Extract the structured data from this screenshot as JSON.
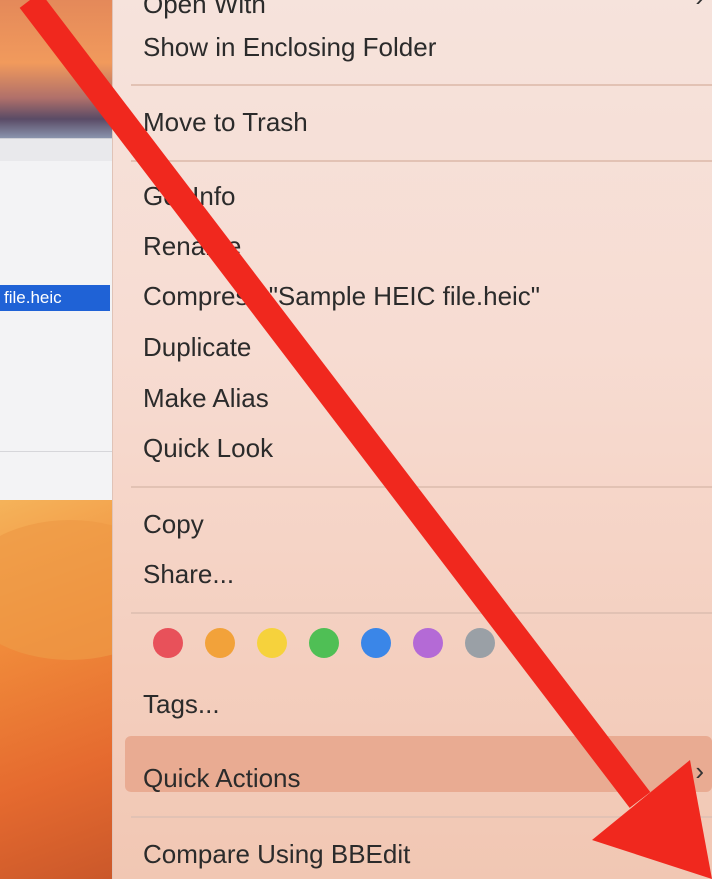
{
  "finder": {
    "selected_file": "file.heic"
  },
  "menu": {
    "items": [
      {
        "label": "Open With",
        "top": 0
      },
      {
        "label": "Show in Enclosing Folder",
        "top": 0
      },
      {
        "label": "Move to Trash",
        "top": 0
      },
      {
        "label": "Get Info",
        "top": 0
      },
      {
        "label": "Rename",
        "top": 0
      },
      {
        "label": "Compress \"Sample HEIC file.heic\"",
        "top": 0
      },
      {
        "label": "Duplicate",
        "top": 0
      },
      {
        "label": "Make Alias",
        "top": 0
      },
      {
        "label": "Quick Look",
        "top": 0
      },
      {
        "label": "Copy",
        "top": 0
      },
      {
        "label": "Share...",
        "top": 0
      },
      {
        "label": "Tags...",
        "top": 0
      },
      {
        "label": "Quick Actions",
        "top": 0
      },
      {
        "label": "Compare Using BBEdit",
        "top": 0
      }
    ],
    "submenu_glyph": "›",
    "tag_colors": [
      "#e8515a",
      "#f2a23a",
      "#f6d23c",
      "#4fbf55",
      "#3a86e8",
      "#b46ad6",
      "#9aa0a6"
    ]
  },
  "annotation": {
    "arrow_color": "#f0281e"
  }
}
